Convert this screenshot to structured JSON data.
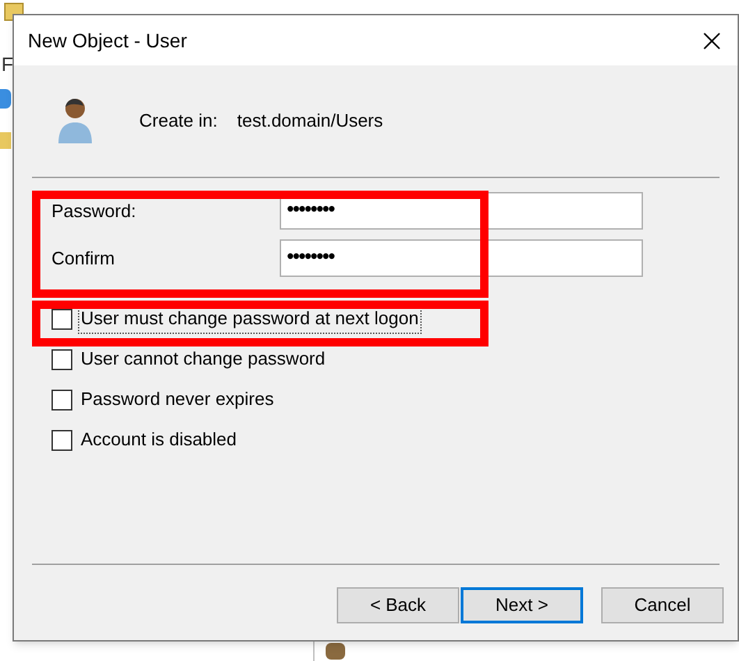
{
  "background_window": {
    "menu_letter": "F"
  },
  "dialog": {
    "title": "New Object - User",
    "create_in_label": "Create in:",
    "create_in_value": "test.domain/Users"
  },
  "fields": [
    {
      "label": "Password:",
      "value": "••••••••"
    },
    {
      "label": "Confirm",
      "value": "••••••••"
    }
  ],
  "checkboxes": [
    {
      "label": "User must change password at next logon",
      "checked": false,
      "focused": true
    },
    {
      "label": "User cannot change password",
      "checked": false,
      "focused": false
    },
    {
      "label": "Password never expires",
      "checked": false,
      "focused": false
    },
    {
      "label": "Account is disabled",
      "checked": false,
      "focused": false
    }
  ],
  "buttons": [
    {
      "label": "< Back",
      "default": false
    },
    {
      "label": "Next >",
      "default": true
    },
    {
      "label": "Cancel",
      "default": false
    }
  ]
}
